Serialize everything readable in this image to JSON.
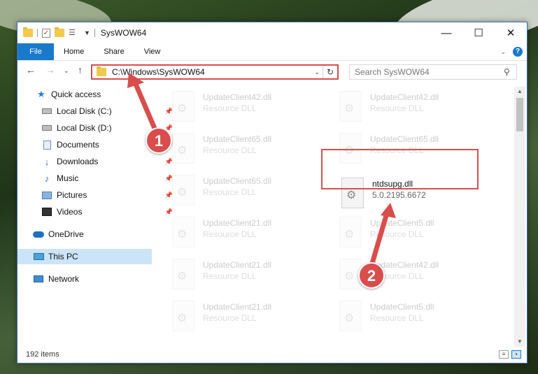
{
  "window": {
    "title": "SysWOW64",
    "controls": {
      "minimize": "—",
      "maximize": "☐",
      "close": "✕"
    }
  },
  "ribbon": {
    "tabs": [
      "File",
      "Home",
      "Share",
      "View"
    ]
  },
  "address": {
    "path": "C:\\Windows\\SysWOW64",
    "search_placeholder": "Search SysWOW64"
  },
  "nav": {
    "items": [
      {
        "label": "Quick access",
        "icon": "star-icon",
        "pinned": false
      },
      {
        "label": "Local Disk (C:)",
        "icon": "drive-icon",
        "pinned": true
      },
      {
        "label": "Local Disk (D:)",
        "icon": "drive-icon",
        "pinned": true
      },
      {
        "label": "Documents",
        "icon": "documents-icon",
        "pinned": true
      },
      {
        "label": "Downloads",
        "icon": "downloads-icon",
        "pinned": true
      },
      {
        "label": "Music",
        "icon": "music-icon",
        "pinned": true
      },
      {
        "label": "Pictures",
        "icon": "pictures-icon",
        "pinned": true
      },
      {
        "label": "Videos",
        "icon": "videos-icon",
        "pinned": true
      },
      {
        "label": "OneDrive",
        "icon": "onedrive-icon",
        "pinned": false
      },
      {
        "label": "This PC",
        "icon": "this-pc-icon",
        "pinned": false,
        "selected": true
      },
      {
        "label": "Network",
        "icon": "network-icon",
        "pinned": false
      }
    ]
  },
  "files": {
    "left": [
      {
        "name": "UpdateClient42.dll",
        "desc": "Resource DLL"
      },
      {
        "name": "UpdateClient65.dll",
        "desc": "Resource DLL"
      },
      {
        "name": "UpdateClient65.dll",
        "desc": "Resource DLL"
      },
      {
        "name": "UpdateClient21.dll",
        "desc": "Resource DLL"
      },
      {
        "name": "UpdateClient21.dll",
        "desc": "Resource DLL"
      },
      {
        "name": "UpdateClient21.dll",
        "desc": "Resource DLL"
      }
    ],
    "right": [
      {
        "name": "UpdateClient42.dll",
        "desc": "Resource DLL"
      },
      {
        "name": "UpdateClient65.dll",
        "desc": "Resource DLL"
      },
      {
        "name": "ntdsupg.dll",
        "desc": "5.0.2195.6672",
        "highlighted": true
      },
      {
        "name": "UpdateClient5.dll",
        "desc": "Resource DLL"
      },
      {
        "name": "UpdateClient42.dll",
        "desc": "Resource DLL"
      },
      {
        "name": "UpdateClient5.dll",
        "desc": "Resource DLL"
      }
    ]
  },
  "status": {
    "item_count": "192 items"
  },
  "annotations": {
    "step1": "1",
    "step2": "2",
    "accent": "#d94d4d"
  }
}
